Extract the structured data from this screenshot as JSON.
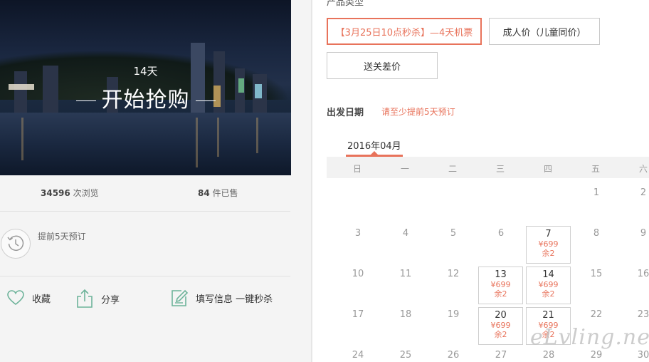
{
  "hero": {
    "days": "14天",
    "title": "开始抢购"
  },
  "stats": {
    "views_num": "34596",
    "views_label": "次浏览",
    "sold_num": "84",
    "sold_label": "件已售"
  },
  "advance_notice": "提前5天预订",
  "actions": {
    "favorite": "收藏",
    "share": "分享",
    "fill_info": "填写信息 一键秒杀"
  },
  "product_type": {
    "title": "产品类型",
    "options": [
      "【3月25日10点秒杀】—4天机票",
      "成人价（儿童同价）",
      "送关差价"
    ]
  },
  "departure": {
    "title": "出发日期",
    "hint": "请至少提前5天预订"
  },
  "calendar": {
    "month_label": "2016年04月",
    "weekdays": [
      "日",
      "一",
      "二",
      "三",
      "四",
      "五",
      "六"
    ],
    "row1": [
      "1",
      "2"
    ],
    "row2": [
      "3",
      "4",
      "5",
      "6",
      "7",
      "8",
      "9"
    ],
    "row3": [
      "10",
      "11",
      "12",
      "13",
      "14",
      "15",
      "16"
    ],
    "row4": [
      "17",
      "18",
      "19",
      "20",
      "21",
      "22",
      "23"
    ],
    "row5": [
      "24",
      "25",
      "26",
      "27",
      "28",
      "29",
      "30"
    ],
    "available": [
      {
        "day": "7",
        "price": "¥699",
        "remain": "余2"
      },
      {
        "day": "13",
        "price": "¥699",
        "remain": "余2"
      },
      {
        "day": "14",
        "price": "¥699",
        "remain": "余2"
      },
      {
        "day": "20",
        "price": "¥699",
        "remain": "余2"
      },
      {
        "day": "21",
        "price": "¥699",
        "remain": "余2"
      }
    ]
  },
  "watermark": "eLvling.net",
  "colors": {
    "accent": "#e8735b",
    "icon_green": "#6db39a"
  }
}
